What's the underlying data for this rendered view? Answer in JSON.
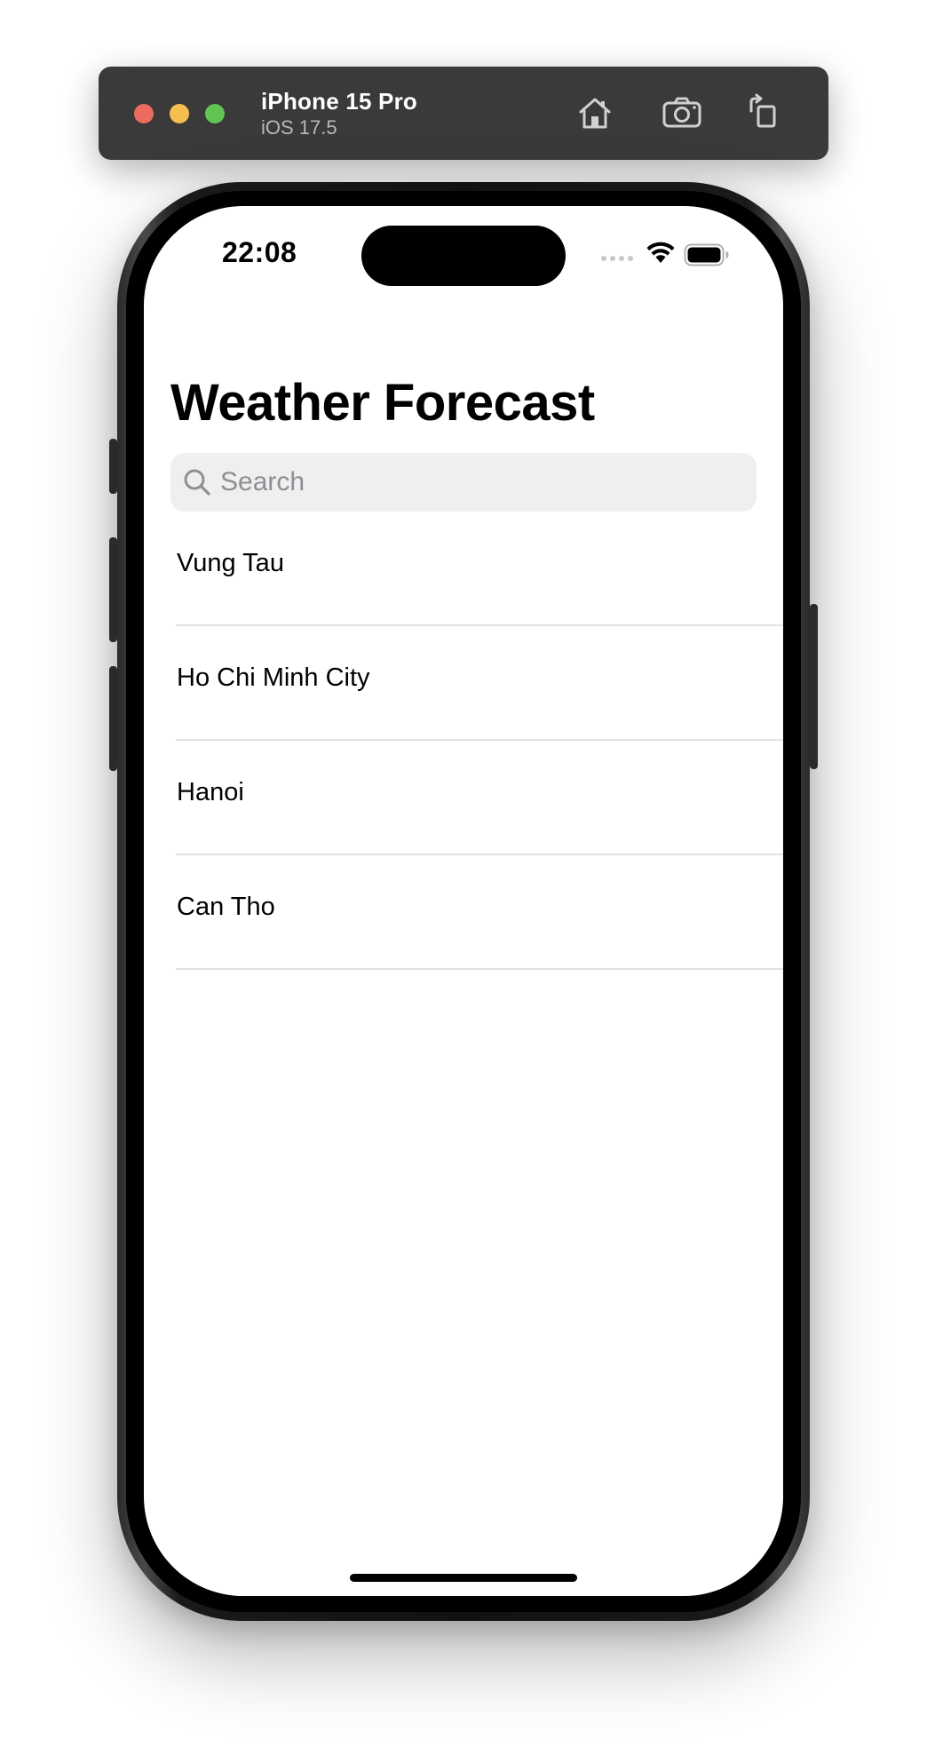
{
  "simulator": {
    "device_name": "iPhone 15 Pro",
    "os_version": "iOS 17.5",
    "traffic_light_colors": {
      "close": "#ec6a5e",
      "minimize": "#f4bf4f",
      "zoom": "#61c554"
    },
    "toolbar": {
      "home_icon": "home-icon",
      "screenshot_icon": "camera-icon",
      "rotate_icon": "rotate-icon"
    }
  },
  "status_bar": {
    "time": "22:08"
  },
  "app": {
    "title": "Weather Forecast",
    "search": {
      "placeholder": "Search",
      "value": ""
    },
    "cities": [
      {
        "name": "Vung Tau"
      },
      {
        "name": "Ho Chi Minh City"
      },
      {
        "name": "Hanoi"
      },
      {
        "name": "Can Tho"
      }
    ]
  }
}
